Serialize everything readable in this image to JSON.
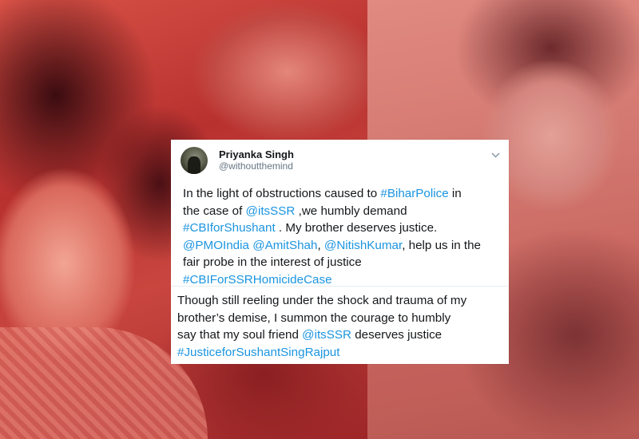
{
  "tweet1": {
    "display_name": "Priyanka Singh",
    "handle": "@withoutthemind",
    "icons": {
      "avatar": "profile-photo",
      "menu": "chevron-down-icon"
    },
    "lines": [
      [
        {
          "t": "In the light of obstructions caused to ",
          "k": "text"
        },
        {
          "t": "#BiharPolice",
          "k": "link"
        },
        {
          "t": " in",
          "k": "text"
        }
      ],
      [
        {
          "t": "the case of ",
          "k": "text"
        },
        {
          "t": "@itsSSR",
          "k": "link"
        },
        {
          "t": " ,we humbly demand",
          "k": "text"
        }
      ],
      [
        {
          "t": "#CBIforShushant",
          "k": "link"
        },
        {
          "t": " . My brother deserves justice.",
          "k": "text"
        }
      ],
      [
        {
          "t": "@PMOIndia",
          "k": "link"
        },
        {
          "t": " ",
          "k": "text"
        },
        {
          "t": "@AmitShah",
          "k": "link"
        },
        {
          "t": ", ",
          "k": "text"
        },
        {
          "t": "@NitishKumar",
          "k": "link"
        },
        {
          "t": ", help us in the",
          "k": "text"
        }
      ],
      [
        {
          "t": "fair probe in the interest of justice",
          "k": "text"
        }
      ],
      [
        {
          "t": "#CBIForSSRHomicideCase",
          "k": "link"
        }
      ]
    ]
  },
  "tweet2": {
    "lines": [
      [
        {
          "t": "Though still reeling under the shock and trauma of my",
          "k": "text"
        }
      ],
      [
        {
          "t": "brother’s demise, I summon the courage to humbly",
          "k": "text"
        }
      ],
      [
        {
          "t": "say that my soul friend ",
          "k": "text"
        },
        {
          "t": "@itsSSR",
          "k": "link"
        },
        {
          "t": " deserves justice",
          "k": "text"
        }
      ],
      [
        {
          "t": "#JusticeforSushantSingRajput",
          "k": "link"
        }
      ]
    ]
  },
  "colors": {
    "link": "#1b95e0",
    "text": "#14171a",
    "handle": "#657786",
    "overlay_red": "#c9463f"
  }
}
